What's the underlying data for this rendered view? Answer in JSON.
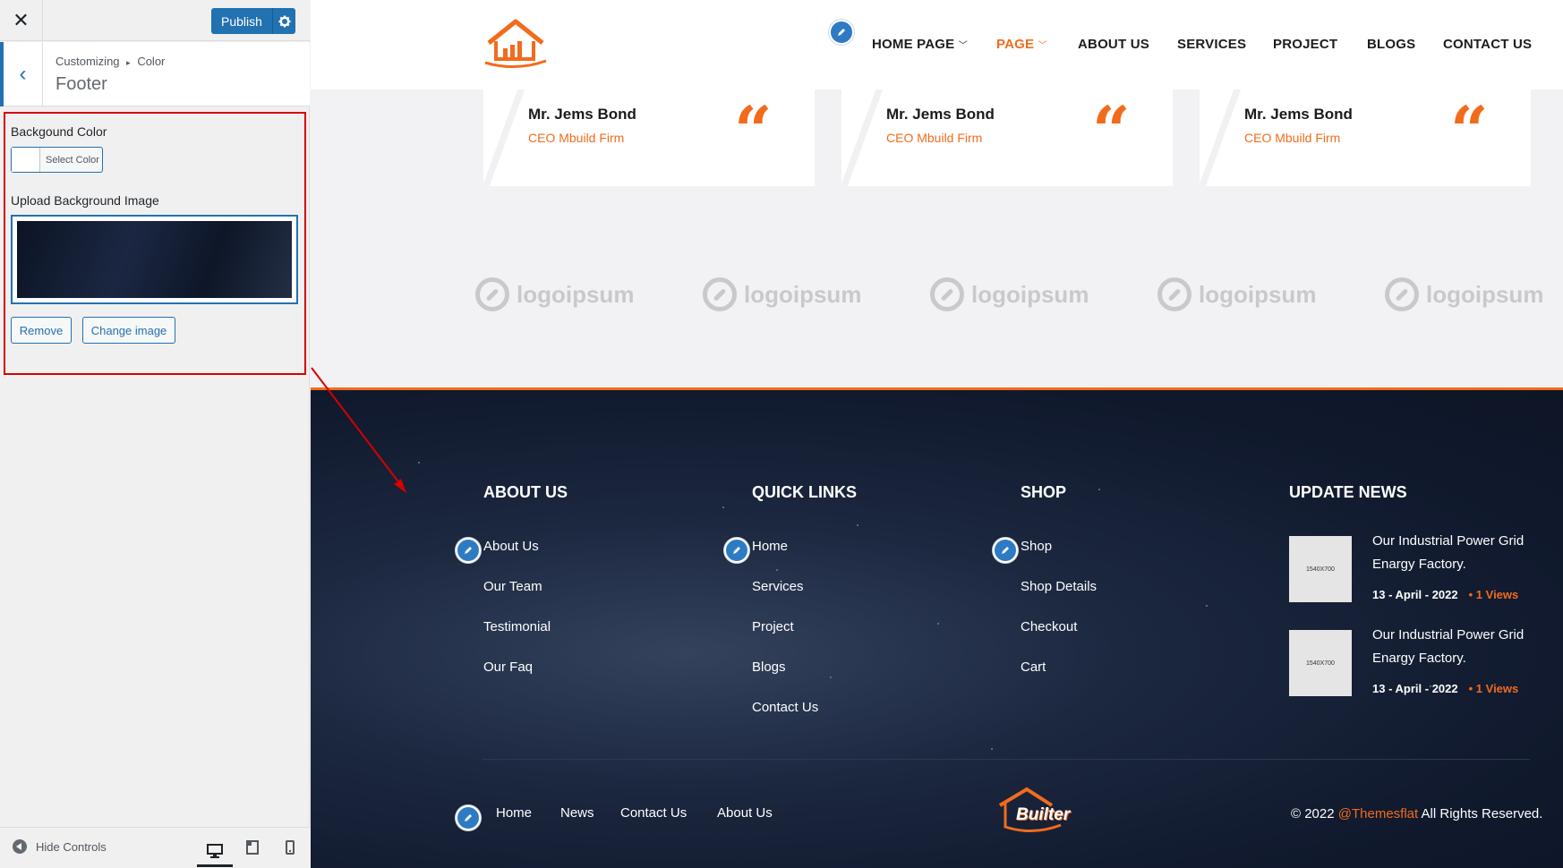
{
  "sidebar": {
    "publish_label": "Publish",
    "breadcrumb_root": "Customizing",
    "breadcrumb_sep": "▸",
    "breadcrumb_parent": "Color",
    "section_title": "Footer",
    "bg_color_label": "Backgound Color",
    "select_color_label": "Select Color",
    "upload_label": "Upload Background Image",
    "remove_label": "Remove",
    "change_label": "Change image",
    "hide_controls_label": "Hide Controls"
  },
  "nav": {
    "items": [
      "HOME PAGE",
      "PAGE",
      "ABOUT US",
      "SERVICES",
      "PROJECT",
      "BLOGS",
      "CONTACT US"
    ],
    "active": "PAGE"
  },
  "testimonials": [
    {
      "name": "Mr. Jems Bond",
      "role": "CEO Mbuild Firm"
    },
    {
      "name": "Mr. Jems Bond",
      "role": "CEO Mbuild Firm"
    },
    {
      "name": "Mr. Jems Bond",
      "role": "CEO Mbuild Firm"
    }
  ],
  "quote_glyph": "“",
  "partner_logos": [
    "logoipsum",
    "logoipsum",
    "logoipsum",
    "logoipsum",
    "logoipsum"
  ],
  "footer": {
    "columns": [
      {
        "heading": "ABOUT US",
        "links": [
          "About Us",
          "Our Team",
          "Testimonial",
          "Our Faq"
        ]
      },
      {
        "heading": "QUICK LINKS",
        "links": [
          "Home",
          "Services",
          "Project",
          "Blogs",
          "Contact Us"
        ]
      },
      {
        "heading": "SHOP",
        "links": [
          "Shop",
          "Shop Details",
          "Checkout",
          "Cart"
        ]
      }
    ],
    "news_heading": "UPDATE NEWS",
    "news": [
      {
        "thumb": "1540X700",
        "title": "Our Industrial Power Grid Enargy Factory.",
        "date": "13 - April - 2022",
        "views": "• 1 Views"
      },
      {
        "thumb": "1540X700",
        "title": "Our Industrial Power Grid Enargy Factory.",
        "date": "13 - April - 2022",
        "views": "• 1 Views"
      }
    ],
    "bottom_links": [
      "Home",
      "News",
      "Contact Us",
      "About Us"
    ],
    "logo_text": "Builter",
    "copyright_prefix": "© 2022",
    "copyright_brand": "@Themesflat",
    "copyright_suffix": "All Rights Reserved."
  },
  "colors": {
    "accent": "#f26b1d",
    "wp_blue": "#2271b1",
    "footer_bg": "#141d31",
    "annotation": "#d60000"
  }
}
